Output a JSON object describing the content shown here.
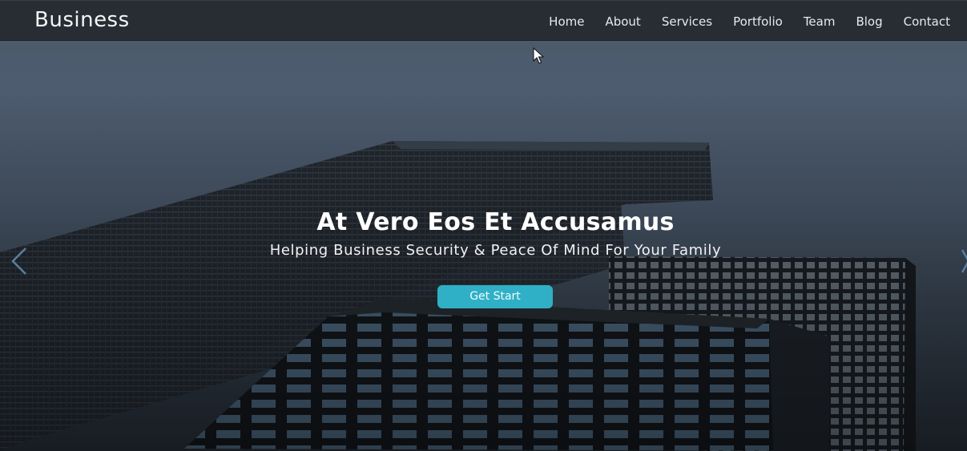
{
  "navbar": {
    "brand": "Business",
    "links": [
      "Home",
      "About",
      "Services",
      "Portfolio",
      "Team",
      "Blog",
      "Contact"
    ]
  },
  "hero": {
    "title": "At Vero Eos Et Accusamus",
    "subtitle": "Helping Business Security & Peace Of Mind For Your Family",
    "cta_label": "Get Start"
  },
  "icons": {
    "prev": "chevron-left-icon",
    "next": "chevron-right-icon",
    "cursor": "mouse-pointer-icon"
  },
  "colors": {
    "navbar_bg": "#26292e",
    "cta_bg": "#2fb0c6",
    "text": "#ffffff"
  }
}
